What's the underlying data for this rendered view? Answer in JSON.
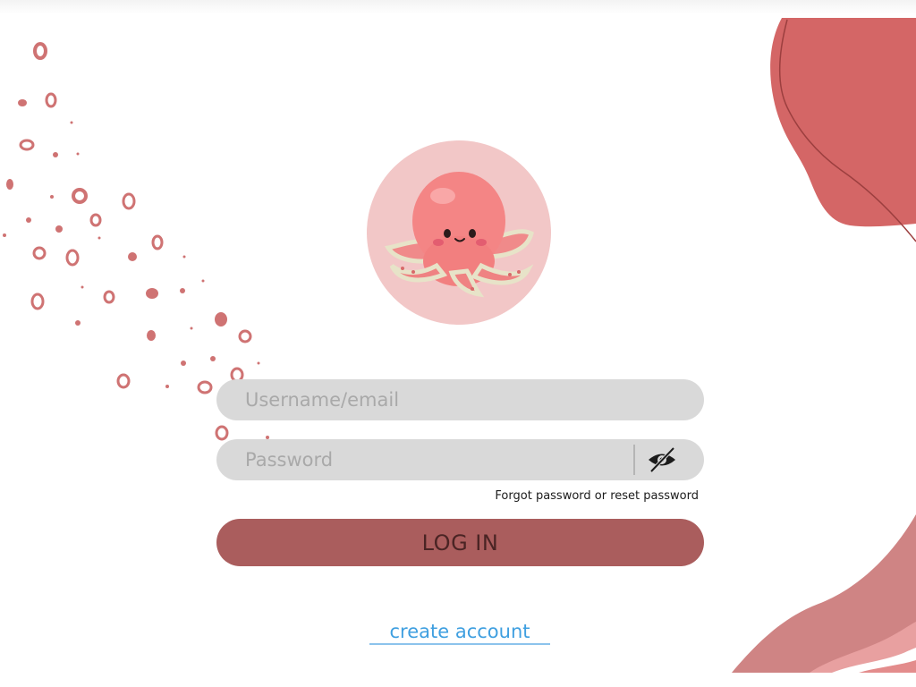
{
  "login_form": {
    "username_placeholder": "Username/email",
    "password_placeholder": "Password",
    "forgot_link": "Forgot password or reset password",
    "login_button": "LOG IN",
    "create_account_link": "create account"
  },
  "icons": {
    "avatar": "octopus-mascot",
    "password_toggle": "eye-slash-icon"
  },
  "colors": {
    "accent": "#aa5d5d",
    "avatar_bg": "#f2c7c7",
    "field_bg": "#d9d9d9",
    "link": "#3f9fe0",
    "blob": "#d46666",
    "dots": "#cf7373"
  }
}
